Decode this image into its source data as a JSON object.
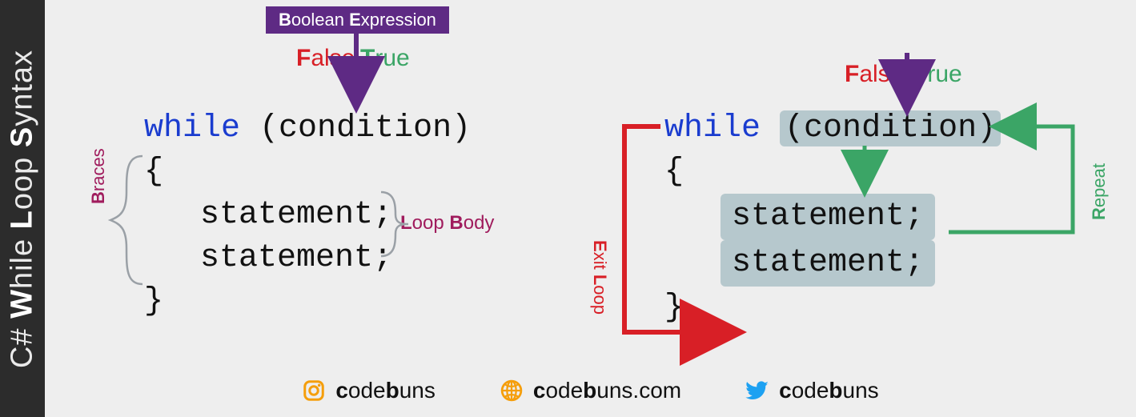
{
  "sidebar": {
    "title_parts": [
      "C# ",
      "W",
      "hile ",
      "L",
      "oop ",
      "S",
      "yntax"
    ]
  },
  "left": {
    "bool_box": "Boolean Expression",
    "false": "False",
    "true": "True",
    "braces": "Braces",
    "loop_body": "Loop Body",
    "code": {
      "kw": "while",
      "cond": "(condition)",
      "brace_open": "{",
      "stmt1": "statement;",
      "stmt2": "statement;",
      "brace_close": "}"
    }
  },
  "right": {
    "false": "False",
    "true": "True",
    "exit": "Exit Loop",
    "repeat": "Repeat",
    "code": {
      "kw": "while",
      "cond": "(condition)",
      "brace_open": "{",
      "stmt1": "statement;",
      "stmt2": "statement;",
      "brace_close": "}"
    }
  },
  "footer": {
    "instagram": "codebuns",
    "web": "codebuns.com",
    "twitter": "codebuns"
  },
  "colors": {
    "purple": "#5e2a84",
    "red": "#d81f26",
    "green": "#3ba566",
    "magenta": "#a01c5d",
    "blue": "#1a3ccf",
    "orange": "#f59e0b",
    "twitter": "#1da1f2",
    "highlight": "#b6c8cd"
  }
}
